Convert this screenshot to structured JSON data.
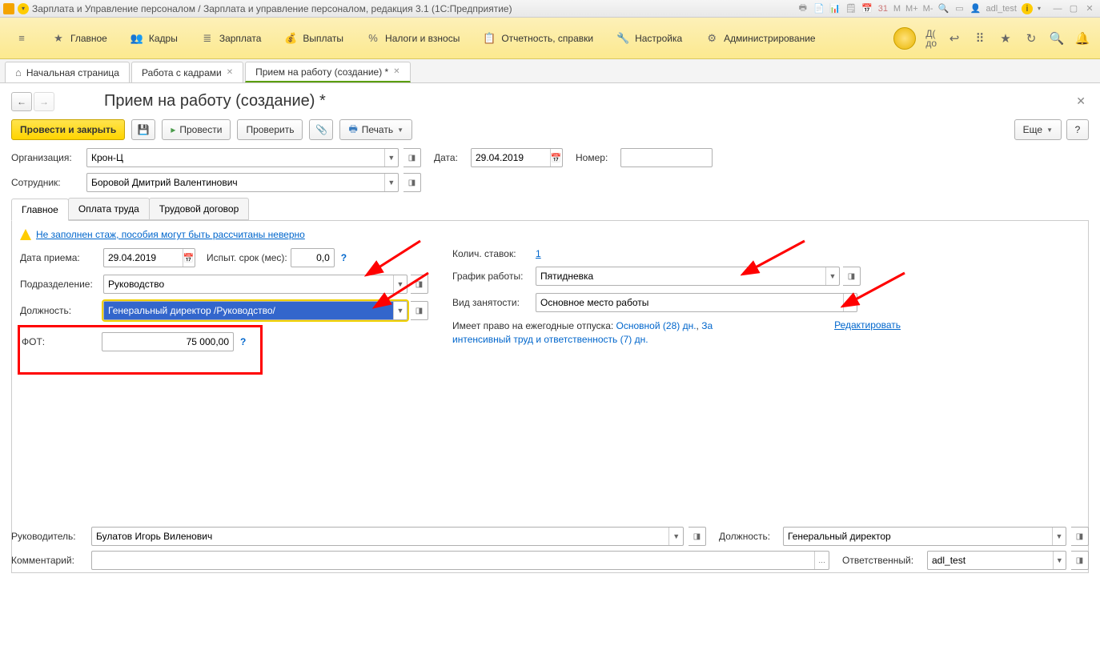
{
  "titlebar": {
    "title": "Зарплата и Управление персоналом / Зарплата и управление персоналом, редакция 3.1 (1С:Предприятие)",
    "user": "adl_test",
    "m": "M",
    "mp": "M+",
    "mm": "M-"
  },
  "mainmenu": {
    "items": [
      {
        "icon": "≡",
        "label": ""
      },
      {
        "icon": "★",
        "label": "Главное"
      },
      {
        "icon": "👥",
        "label": "Кадры"
      },
      {
        "icon": "₽",
        "label": "Зарплата"
      },
      {
        "icon": "💰",
        "label": "Выплаты"
      },
      {
        "icon": "%",
        "label": "Налоги и взносы"
      },
      {
        "icon": "📋",
        "label": "Отчетность, справки"
      },
      {
        "icon": "🔧",
        "label": "Настройка"
      },
      {
        "icon": "⚙",
        "label": "Администрирование"
      }
    ],
    "shortcuts": {
      "d1": "Д(",
      "d2": "до"
    }
  },
  "tabs": [
    {
      "label": "Начальная страница",
      "home": true,
      "closable": false
    },
    {
      "label": "Работа с кадрами",
      "closable": true
    },
    {
      "label": "Прием на работу (создание) *",
      "closable": true,
      "active": true
    }
  ],
  "page": {
    "title": "Прием на работу (создание) *"
  },
  "toolbar": {
    "post_close": "Провести и закрыть",
    "post": "Провести",
    "check": "Проверить",
    "print": "Печать",
    "more": "Еще",
    "help": "?"
  },
  "header_form": {
    "org_label": "Организация:",
    "org_value": "Крон-Ц",
    "date_label": "Дата:",
    "date_value": "29.04.2019",
    "number_label": "Номер:",
    "number_value": "",
    "employee_label": "Сотрудник:",
    "employee_value": "Боровой Дмитрий Валентинович"
  },
  "inner_tabs": [
    "Главное",
    "Оплата труда",
    "Трудовой договор"
  ],
  "warning": "Не заполнен стаж, пособия могут быть рассчитаны неверно",
  "main_form": {
    "hire_date_label": "Дата приема:",
    "hire_date_value": "29.04.2019",
    "probation_label": "Испыт. срок (мес):",
    "probation_value": "0,0",
    "department_label": "Подразделение:",
    "department_value": "Руководство",
    "position_label": "Должность:",
    "position_value": "Генеральный директор /Руководство/",
    "fot_label": "ФОТ:",
    "fot_value": "75 000,00",
    "rates_label": "Колич. ставок:",
    "rates_value": "1",
    "schedule_label": "График работы:",
    "schedule_value": "Пятидневка",
    "employment_label": "Вид занятости:",
    "employment_value": "Основное место работы",
    "vacation_prefix": "Имеет право на ежегодные отпуска: ",
    "vacation_main": "Основной (28) дн.",
    "vacation_sep": ", ",
    "vacation_extra": "За интенсивный труд и ответственность (7) дн.",
    "edit": "Редактировать"
  },
  "footer": {
    "manager_label": "Руководитель:",
    "manager_value": "Булатов Игорь Виленович",
    "position_label": "Должность:",
    "position_value": "Генеральный директор",
    "comment_label": "Комментарий:",
    "comment_value": "",
    "responsible_label": "Ответственный:",
    "responsible_value": "adl_test"
  }
}
